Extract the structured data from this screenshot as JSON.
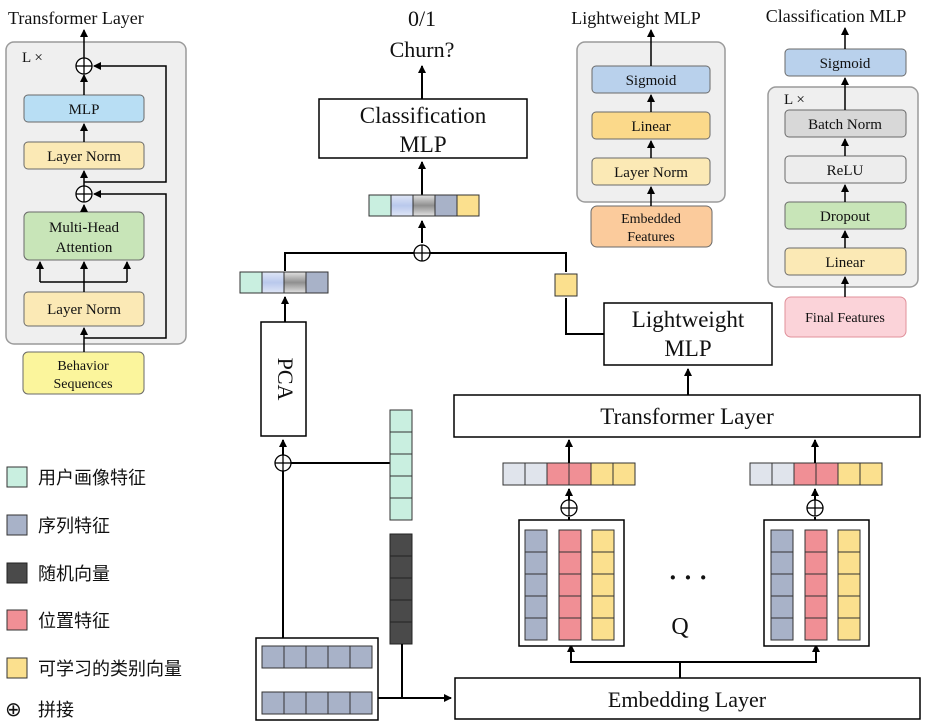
{
  "transformer_panel": {
    "title": "Transformer Layer",
    "repeat": "L ×",
    "mlp": "MLP",
    "layer_norm_top": "Layer Norm",
    "mha_line1": "Multi-Head",
    "mha_line2": "Attention",
    "layer_norm_bottom": "Layer Norm",
    "input_line1": "Behavior",
    "input_line2": "Sequences"
  },
  "output": {
    "label_line1": "0/1",
    "label_line2": "Churn?"
  },
  "classification_block": {
    "line1": "Classification",
    "line2": "MLP"
  },
  "lightweight_panel": {
    "title": "Lightweight MLP",
    "sigmoid": "Sigmoid",
    "linear": "Linear",
    "layer_norm": "Layer Norm",
    "input_line1": "Embedded",
    "input_line2": "Features"
  },
  "classification_panel": {
    "title": "Classification MLP",
    "sigmoid": "Sigmoid",
    "repeat": "L ×",
    "batch_norm": "Batch Norm",
    "relu": "ReLU",
    "dropout": "Dropout",
    "linear": "Linear",
    "input": "Final Features"
  },
  "main": {
    "pca": "PCA",
    "lightweight_line1": "Lightweight",
    "lightweight_line2": "MLP",
    "transformer": "Transformer Layer",
    "embedding": "Embedding Layer",
    "ellipsis": "· · ·",
    "q": "Q"
  },
  "legend": {
    "user_profile": "用户画像特征",
    "sequence": "序列特征",
    "random": "随机向量",
    "position": "位置特征",
    "category": "可学习的类别向量",
    "concat_symbol": "⊕",
    "concat": "拼接"
  },
  "colors": {
    "user_profile": "#c9efe0",
    "sequence": "#a8b2c8",
    "random": "#4a4a4a",
    "position": "#f08f95",
    "category": "#fbe08e",
    "gray_token": "#a9a9a9",
    "panel_bg": "#efefef",
    "mlp_blue": "#b8def4",
    "sigmoid_blue": "#b9d1ec",
    "layer_norm": "#fbe9b5",
    "mha_green": "#c8e5b8",
    "behavior_yellow": "#fbf59c",
    "embedded_orange": "#fbcb9c",
    "final_pink": "#fbd3d9",
    "batch_gray": "#d8d8d8",
    "relu_gray": "#ededed"
  }
}
